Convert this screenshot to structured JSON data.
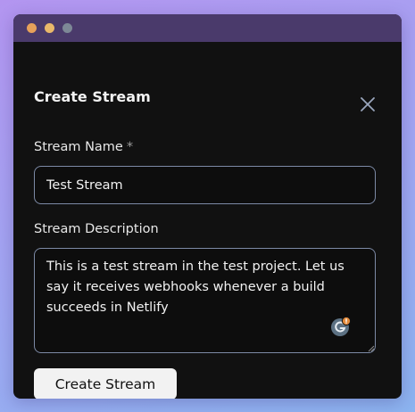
{
  "colors": {
    "titlebar": "#4a3a6b",
    "window_bg": "#111111",
    "dot_close": "#e6a15a",
    "dot_minimize": "#e9b86a",
    "dot_maximize": "#7d8896",
    "input_border": "#7d8aa6",
    "button_bg": "#f2f2f2"
  },
  "dialog": {
    "title": "Create Stream",
    "close_icon": "close-icon"
  },
  "form": {
    "name_label": "Stream Name",
    "name_required_marker": "*",
    "name_value": "Test Stream",
    "description_label": "Stream Description",
    "description_value": "This is a test stream in the test project. Let us say it receives webhooks whenever a build succeeds in Netlify",
    "grammarly_icon": "grammarly-icon",
    "submit_label": "Create Stream"
  }
}
